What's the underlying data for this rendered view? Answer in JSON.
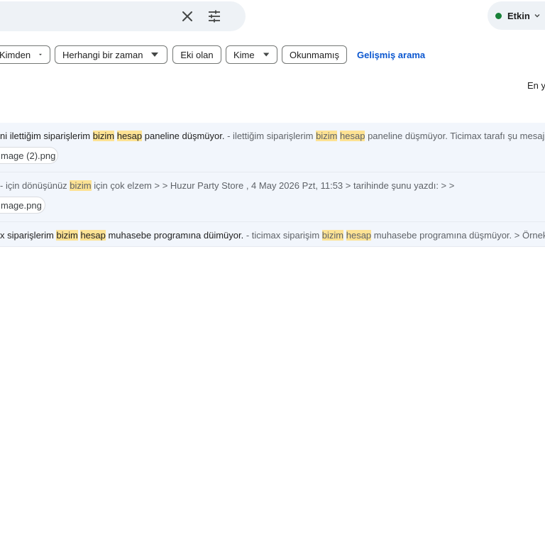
{
  "search": {
    "clear_icon": "close-icon",
    "options_icon": "tune-icon"
  },
  "status": {
    "label": "Etkin",
    "dot_color": "#188038",
    "chevron_icon": "chevron-down-icon"
  },
  "filters": {
    "from": "Kimden",
    "any_time": "Herhangi bir zaman",
    "has_attachment": "Eki olan",
    "to": "Kime",
    "unread": "Okunmamış",
    "advanced_search": "Gelişmiş arama"
  },
  "sort_label": "En y",
  "highlight_color": "#fde293",
  "messages": [
    {
      "subject_parts": [
        "ni ilettiğim siparişlerim ",
        "bizim",
        " ",
        "hesap",
        " paneline düşmüyor."
      ],
      "snippet_parts": [
        "  - ilettiğim siparişlerim ",
        "bizim",
        " ",
        "hesap",
        " paneline düşmüyor. Ticimax tarafı şu mesajı iletti: i"
      ],
      "attachment": "mage (2).png"
    },
    {
      "subject_parts": [],
      "snippet_parts": [
        "- için dönüşünüz ",
        "bizim",
        " için çok elzem > > Huzur Party Store , 4 May 2026 Pzt, 11:53 > tarihinde şunu yazdı: > >"
      ],
      "attachment": "mage.png"
    },
    {
      "subject_parts": [
        "x siparişlerim ",
        "bizim",
        " ",
        "hesap",
        " muhasebe programına düimüyor."
      ],
      "snippet_parts": [
        " - ticimax siparişim ",
        "bizim",
        " ",
        "hesap",
        " muhasebe programına düşmüyor. > Örnek sipariş"
      ],
      "attachment": ""
    }
  ]
}
